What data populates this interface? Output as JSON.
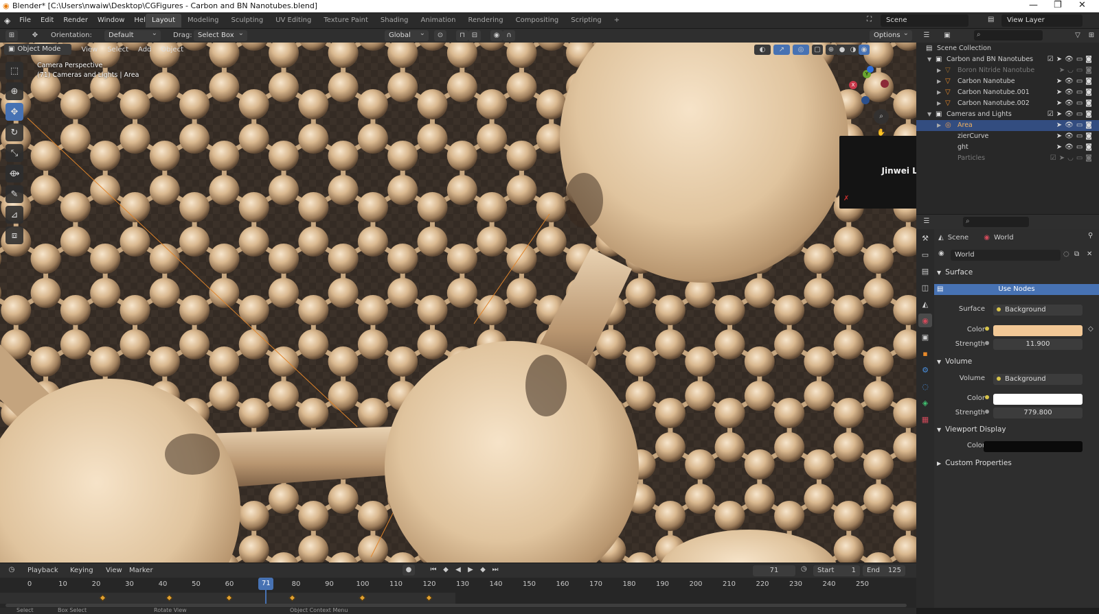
{
  "window": {
    "title": "Blender* [C:\\Users\\nwaiw\\Desktop\\CGFigures - Carbon and BN Nanotubes.blend]",
    "controls": [
      "—",
      "❐",
      "✕"
    ]
  },
  "menubar": {
    "items": [
      "File",
      "Edit",
      "Render",
      "Window",
      "Help"
    ],
    "workspaces": [
      "Layout",
      "Modeling",
      "Sculpting",
      "UV Editing",
      "Texture Paint",
      "Shading",
      "Animation",
      "Rendering",
      "Compositing",
      "Scripting"
    ],
    "active_workspace": "Layout",
    "add_tab": "+",
    "scene_label": "Scene",
    "view_layer_label": "View Layer"
  },
  "toolheader": {
    "orientation_label": "Orientation:",
    "orientation_value": "Default",
    "drag_label": "Drag:",
    "drag_value": "Select Box",
    "transform_space": "Global",
    "options": "Options"
  },
  "viewport": {
    "mode": "Object Mode",
    "menus": [
      "View",
      "Select",
      "Add",
      "Object"
    ],
    "overlay_line1": "Camera Perspective",
    "overlay_line2": "(71) Cameras and Lights | Area",
    "tools": [
      "select-box",
      "cursor",
      "move",
      "rotate",
      "scale",
      "transform",
      "annotate",
      "measure",
      "add-cube"
    ],
    "active_tool": "move"
  },
  "popup": {
    "name": "Jinwei Liu"
  },
  "outliner": {
    "root": "Scene Collection",
    "rows": [
      {
        "name": "Carbon and BN Nanotubes",
        "level": 1,
        "type": "collection",
        "expanded": true
      },
      {
        "name": "Boron Nitride Nanotube",
        "level": 2,
        "type": "mesh",
        "dim": true
      },
      {
        "name": "Carbon Nanotube",
        "level": 2,
        "type": "mesh"
      },
      {
        "name": "Carbon Nanotube.001",
        "level": 2,
        "type": "mesh"
      },
      {
        "name": "Carbon Nanotube.002",
        "level": 2,
        "type": "mesh"
      },
      {
        "name": "Cameras and Lights",
        "level": 1,
        "type": "collection",
        "expanded": true
      },
      {
        "name": "Area",
        "level": 2,
        "type": "light",
        "selected": true
      },
      {
        "name": "zierCurve",
        "level": 2,
        "type": "curve"
      },
      {
        "name": "ght",
        "level": 2,
        "type": "light"
      },
      {
        "name": "Particles",
        "level": 2,
        "type": "particles",
        "dim": true
      }
    ]
  },
  "properties": {
    "breadcrumb_scene": "Scene",
    "breadcrumb_world": "World",
    "world_name": "World",
    "surface_section": "Surface",
    "use_nodes": "Use Nodes",
    "surface_label": "Surface",
    "surface_value": "Background",
    "color_label": "Color",
    "surface_color": "#f2c896",
    "strength_label": "Strength",
    "surface_strength": "11.900",
    "volume_section": "Volume",
    "volume_label": "Volume",
    "volume_value": "Background",
    "volume_color": "#ffffff",
    "volume_strength": "779.800",
    "viewport_display_section": "Viewport Display",
    "viewport_color": "#0a0a0a",
    "custom_properties_section": "Custom Properties"
  },
  "timeline": {
    "menus": [
      "Playback",
      "Keying",
      "View",
      "Marker"
    ],
    "current_frame": "71",
    "start_label": "Start",
    "start_value": "1",
    "end_label": "End",
    "end_value": "125",
    "ticks": [
      "0",
      "10",
      "20",
      "30",
      "40",
      "50",
      "60",
      "80",
      "90",
      "100",
      "110",
      "120",
      "130",
      "140",
      "150",
      "160",
      "170",
      "180",
      "190",
      "200",
      "210",
      "220",
      "230",
      "240",
      "250"
    ],
    "keyframes": [
      22,
      42,
      60,
      79,
      100,
      120
    ]
  },
  "statusbar": {
    "items": [
      "Select",
      "Box Select",
      "Rotate View",
      "Object Context Menu"
    ]
  }
}
